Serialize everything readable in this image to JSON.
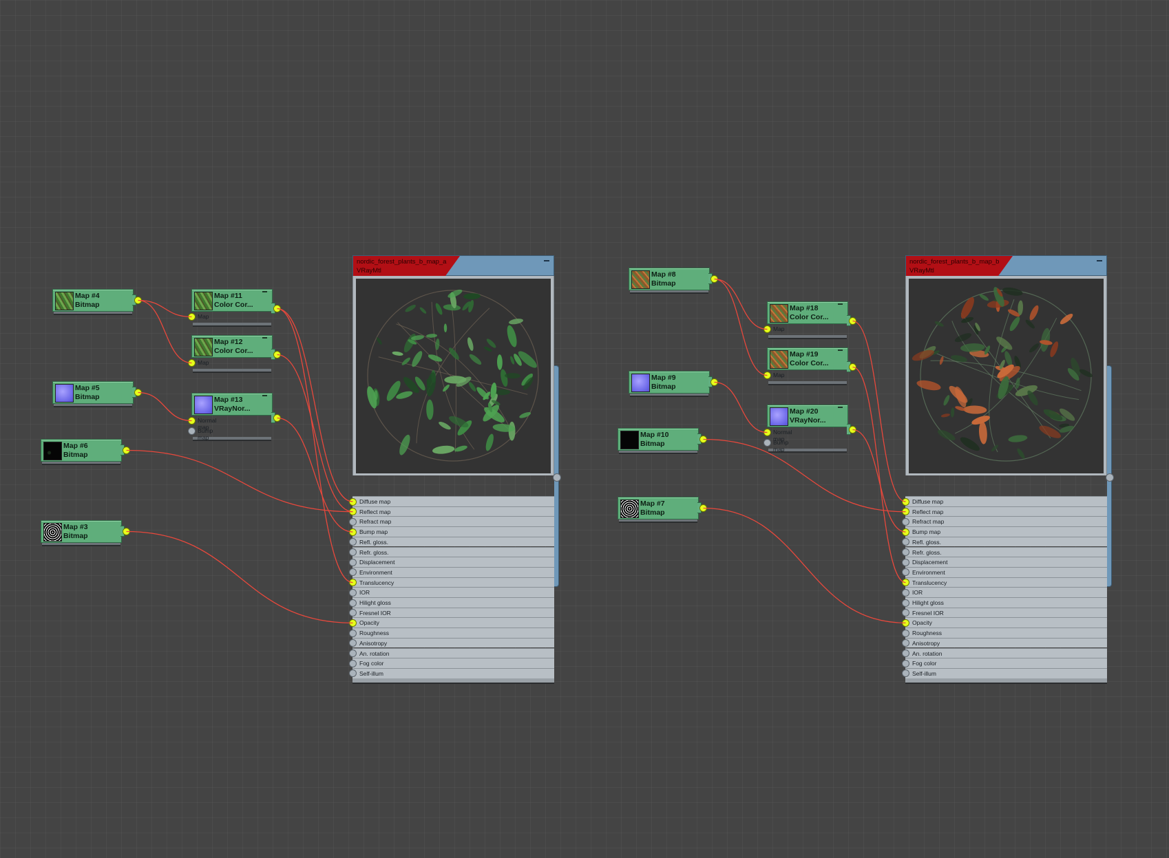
{
  "colors": {
    "background": "#444444",
    "wire": "#e8483c",
    "socket_connected": "#e7ff1c",
    "map_node": "#5fae7b",
    "material_header_red": "#b20f15",
    "material_header_blue": "#6f98b9"
  },
  "materials": [
    {
      "id": "mat_a",
      "name": "nordic_forest_plants_b_map_a",
      "type": "VRayMtl",
      "preview": "green-leaves-sphere",
      "slots": [
        "Diffuse map",
        "Reflect map",
        "Refract map",
        "Bump map",
        "Refl. gloss.",
        "Refr. gloss.",
        "Displacement",
        "Environment",
        "Translucency",
        "IOR",
        "Hilight gloss",
        "Fresnel IOR",
        "Opacity",
        "Roughness",
        "Anisotropy",
        "An. rotation",
        "Fog color",
        "Self-illum"
      ],
      "connected_slots": [
        "Diffuse map",
        "Reflect map",
        "Bump map",
        "Translucency",
        "Opacity"
      ]
    },
    {
      "id": "mat_b",
      "name": "nordic_forest_plants_b_map_b",
      "type": "VRayMtl",
      "preview": "mixed-foliage-sphere",
      "slots": [
        "Diffuse map",
        "Reflect map",
        "Refract map",
        "Bump map",
        "Refl. gloss.",
        "Refr. gloss.",
        "Displacement",
        "Environment",
        "Translucency",
        "IOR",
        "Hilight gloss",
        "Fresnel IOR",
        "Opacity",
        "Roughness",
        "Anisotropy",
        "An. rotation",
        "Fog color",
        "Self-illum"
      ],
      "connected_slots": [
        "Diffuse map",
        "Reflect map",
        "Bump map",
        "Translucency",
        "Opacity"
      ]
    }
  ],
  "map_nodes": [
    {
      "id": "m4",
      "title": "Map #4",
      "type": "Bitmap",
      "thumb": "green-texture"
    },
    {
      "id": "m5",
      "title": "Map #5",
      "type": "Bitmap",
      "thumb": "normal-texture"
    },
    {
      "id": "m6",
      "title": "Map #6",
      "type": "Bitmap",
      "thumb": "dark-texture"
    },
    {
      "id": "m3",
      "title": "Map #3",
      "type": "Bitmap",
      "thumb": "opacity-texture"
    },
    {
      "id": "m11",
      "title": "Map #11",
      "type": "Color Cor...",
      "thumb": "green-texture",
      "slots": [
        "Map"
      ]
    },
    {
      "id": "m12",
      "title": "Map #12",
      "type": "Color Cor...",
      "thumb": "green-texture",
      "slots": [
        "Map"
      ]
    },
    {
      "id": "m13",
      "title": "Map #13",
      "type": "VRayNor...",
      "thumb": "normal-texture",
      "slots": [
        "Normal map",
        "Bump map"
      ]
    },
    {
      "id": "m8",
      "title": "Map #8",
      "type": "Bitmap",
      "thumb": "orange-texture"
    },
    {
      "id": "m9",
      "title": "Map #9",
      "type": "Bitmap",
      "thumb": "normal-texture"
    },
    {
      "id": "m10",
      "title": "Map #10",
      "type": "Bitmap",
      "thumb": "dark-texture"
    },
    {
      "id": "m7",
      "title": "Map #7",
      "type": "Bitmap",
      "thumb": "opacity-texture"
    },
    {
      "id": "m18",
      "title": "Map #18",
      "type": "Color Cor...",
      "thumb": "orange-texture",
      "slots": [
        "Map"
      ]
    },
    {
      "id": "m19",
      "title": "Map #19",
      "type": "Color Cor...",
      "thumb": "orange-texture",
      "slots": [
        "Map"
      ]
    },
    {
      "id": "m20",
      "title": "Map #20",
      "type": "VRayNor...",
      "thumb": "normal-texture",
      "slots": [
        "Normal map",
        "Bump map"
      ]
    }
  ],
  "connections": [
    {
      "from": "m4",
      "to": "m11.Map"
    },
    {
      "from": "m4",
      "to": "m12.Map"
    },
    {
      "from": "m5",
      "to": "m13.Normal map"
    },
    {
      "from": "m11",
      "to": "mat_a.Diffuse map"
    },
    {
      "from": "m11",
      "to": "mat_a.Translucency"
    },
    {
      "from": "m12",
      "to": "mat_a.Reflect map"
    },
    {
      "from": "m13",
      "to": "mat_a.Bump map"
    },
    {
      "from": "m6",
      "to": "mat_a.Reflect map"
    },
    {
      "from": "m3",
      "to": "mat_a.Opacity"
    },
    {
      "from": "m8",
      "to": "m18.Map"
    },
    {
      "from": "m8",
      "to": "m19.Map"
    },
    {
      "from": "m9",
      "to": "m20.Normal map"
    },
    {
      "from": "m18",
      "to": "mat_b.Diffuse map"
    },
    {
      "from": "m19",
      "to": "mat_b.Translucency"
    },
    {
      "from": "m20",
      "to": "mat_b.Bump map"
    },
    {
      "from": "m10",
      "to": "mat_b.Reflect map"
    },
    {
      "from": "m7",
      "to": "mat_b.Opacity"
    }
  ]
}
